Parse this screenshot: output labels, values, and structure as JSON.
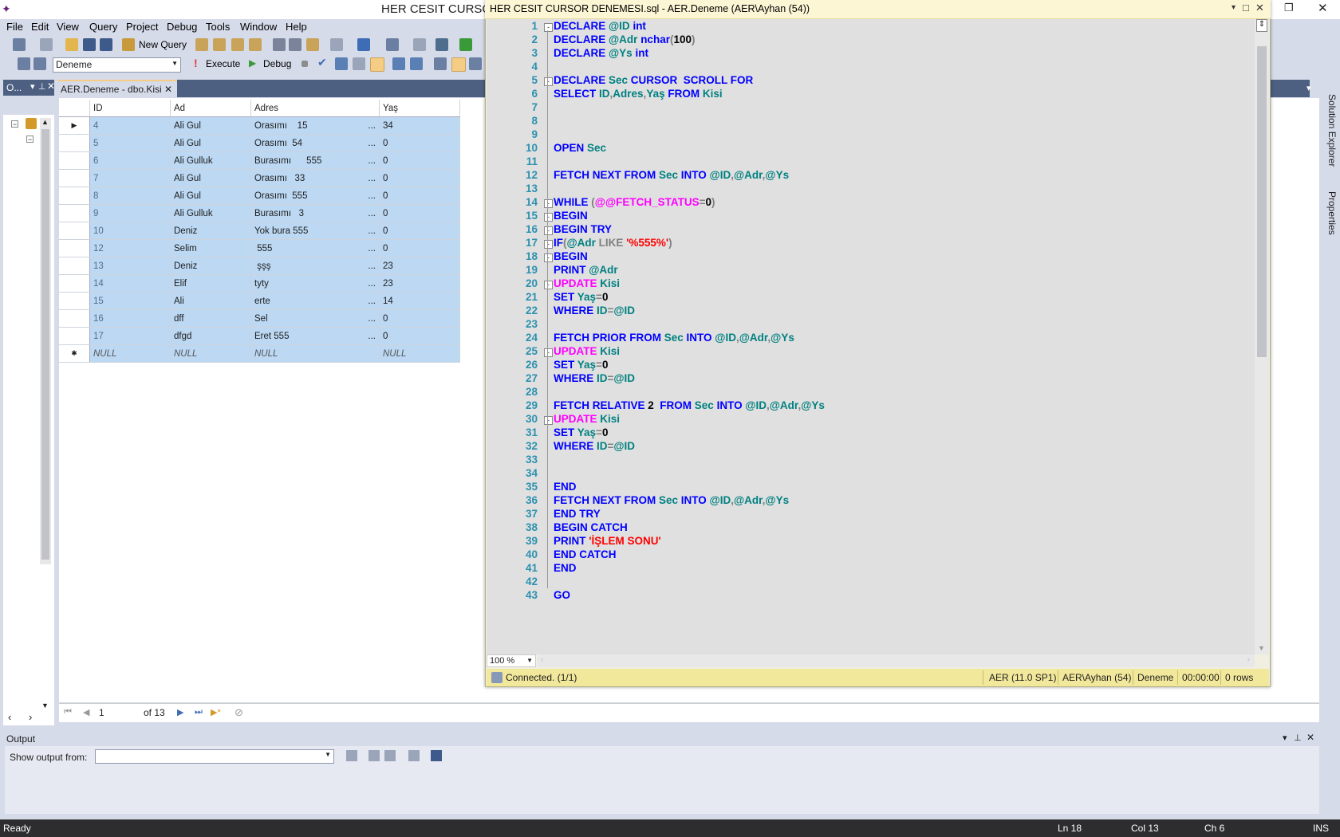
{
  "app": {
    "title": "HER CESIT CURSOR",
    "menu": [
      "File",
      "Edit",
      "View",
      "Query",
      "Project",
      "Debug",
      "Tools",
      "Window",
      "Help"
    ],
    "toolbar": {
      "new_query": "New Query",
      "database": "Deneme",
      "execute": "Execute",
      "debug": "Debug"
    },
    "object_explorer": {
      "title": "O..."
    }
  },
  "grid_doc": {
    "tab_label": "AER.Deneme - dbo.Kisi",
    "columns": [
      "ID",
      "Ad",
      "Adres",
      "Yaş"
    ],
    "rows": [
      {
        "id": "4",
        "ad": "Ali Gul",
        "adres": "Orasımı    15",
        "yas": "34"
      },
      {
        "id": "5",
        "ad": "Ali Gul",
        "adres": "Orasımı  54",
        "yas": "0"
      },
      {
        "id": "6",
        "ad": "Ali Gulluk",
        "adres": "Burasımı      555",
        "yas": "0"
      },
      {
        "id": "7",
        "ad": "Ali Gul",
        "adres": "Orasımı   33",
        "yas": "0"
      },
      {
        "id": "8",
        "ad": "Ali Gul",
        "adres": "Orasımı  555",
        "yas": "0"
      },
      {
        "id": "9",
        "ad": "Ali Gulluk",
        "adres": "Burasımı   3",
        "yas": "0"
      },
      {
        "id": "10",
        "ad": "Deniz",
        "adres": "Yok bura 555",
        "yas": "0"
      },
      {
        "id": "12",
        "ad": "Selim",
        "adres": " 555",
        "yas": "0"
      },
      {
        "id": "13",
        "ad": "Deniz",
        "adres": " şşş",
        "yas": "23"
      },
      {
        "id": "14",
        "ad": "Elif",
        "adres": "tyty",
        "yas": "23"
      },
      {
        "id": "15",
        "ad": "Ali",
        "adres": "erte",
        "yas": "14"
      },
      {
        "id": "16",
        "ad": "dff",
        "adres": "Sel",
        "yas": "0"
      },
      {
        "id": "17",
        "ad": "dfgd",
        "adres": "Eret 555",
        "yas": "0"
      }
    ],
    "new_row": {
      "id": "NULL",
      "ad": "NULL",
      "adres": "NULL",
      "yas": "NULL"
    },
    "ellipsis": "...",
    "nav": {
      "page": "1",
      "of": "of 13"
    }
  },
  "output": {
    "title": "Output",
    "show_from": "Show output from:"
  },
  "statusbar": {
    "ready": "Ready",
    "ln": "Ln 18",
    "col": "Col 13",
    "ch": "Ch 6",
    "ins": "INS"
  },
  "right_rail": {
    "solution_explorer": "Solution Explorer",
    "properties": "Properties"
  },
  "sql_window": {
    "title": "HER CESIT CURSOR DENEMESI.sql - AER.Deneme (AER\\Ayhan (54))",
    "zoom": "100 %",
    "status": {
      "connected": "Connected. (1/1)",
      "server": "AER (11.0 SP1)",
      "user": "AER\\Ayhan (54)",
      "db": "Deneme",
      "time": "00:00:00",
      "rows": "0 rows"
    },
    "lines": [
      {
        "n": "1",
        "fold": "-",
        "t": [
          [
            "kw",
            "DECLARE "
          ],
          [
            "vr",
            "@ID "
          ],
          [
            "kw",
            "int"
          ]
        ]
      },
      {
        "n": "2",
        "t": [
          [
            "kw",
            "DECLARE "
          ],
          [
            "vr",
            "@Adr "
          ],
          [
            "kw",
            "nchar"
          ],
          [
            "gr",
            "("
          ],
          [
            "bk",
            "100"
          ],
          [
            "gr",
            ")"
          ]
        ]
      },
      {
        "n": "3",
        "t": [
          [
            "kw",
            "DECLARE "
          ],
          [
            "vr",
            "@Ys "
          ],
          [
            "kw",
            "int"
          ]
        ]
      },
      {
        "n": "4",
        "t": []
      },
      {
        "n": "5",
        "fold": "-",
        "t": [
          [
            "kw",
            "DECLARE "
          ],
          [
            "vr",
            "Sec "
          ],
          [
            "kw",
            "CURSOR  SCROLL FOR"
          ]
        ]
      },
      {
        "n": "6",
        "t": [
          [
            "kw",
            "SELECT "
          ],
          [
            "vr",
            "ID"
          ],
          [
            "gr",
            ","
          ],
          [
            "vr",
            "Adres"
          ],
          [
            "gr",
            ","
          ],
          [
            "vr",
            "Yaş "
          ],
          [
            "kw",
            "FROM "
          ],
          [
            "vr",
            "Kisi"
          ]
        ]
      },
      {
        "n": "7",
        "t": []
      },
      {
        "n": "8",
        "t": []
      },
      {
        "n": "9",
        "t": []
      },
      {
        "n": "10",
        "t": [
          [
            "kw",
            "OPEN "
          ],
          [
            "vr",
            "Sec"
          ]
        ]
      },
      {
        "n": "11",
        "t": []
      },
      {
        "n": "12",
        "t": [
          [
            "kw",
            "FETCH NEXT FROM "
          ],
          [
            "vr",
            "Sec "
          ],
          [
            "kw",
            "INTO "
          ],
          [
            "vr",
            "@ID"
          ],
          [
            "gr",
            ","
          ],
          [
            "vr",
            "@Adr"
          ],
          [
            "gr",
            ","
          ],
          [
            "vr",
            "@Ys"
          ]
        ]
      },
      {
        "n": "13",
        "t": []
      },
      {
        "n": "14",
        "fold": "-",
        "t": [
          [
            "kw",
            "WHILE "
          ],
          [
            "gr",
            "("
          ],
          [
            "pk",
            "@@FETCH_STATUS"
          ],
          [
            "gr",
            "="
          ],
          [
            "bk",
            "0"
          ],
          [
            "gr",
            ")"
          ]
        ]
      },
      {
        "n": "15",
        "fold": "-",
        "t": [
          [
            "kw",
            "BEGIN"
          ]
        ]
      },
      {
        "n": "16",
        "fold": "-",
        "t": [
          [
            "kw",
            "BEGIN TRY"
          ]
        ]
      },
      {
        "n": "17",
        "fold": "-",
        "t": [
          [
            "kw",
            "IF"
          ],
          [
            "gr",
            "("
          ],
          [
            "vr",
            "@Adr "
          ],
          [
            "gr",
            "LIKE "
          ],
          [
            "st",
            "'%555%'"
          ],
          [
            "gr",
            ")"
          ]
        ]
      },
      {
        "n": "18",
        "fold": "-",
        "t": [
          [
            "kw",
            "BEGIN"
          ]
        ]
      },
      {
        "n": "19",
        "t": [
          [
            "kw",
            "PRINT "
          ],
          [
            "vr",
            "@Adr"
          ]
        ]
      },
      {
        "n": "20",
        "fold": "-",
        "t": [
          [
            "pk",
            "UPDATE "
          ],
          [
            "vr",
            "Kisi"
          ]
        ]
      },
      {
        "n": "21",
        "t": [
          [
            "kw",
            "SET "
          ],
          [
            "vr",
            "Yaş"
          ],
          [
            "gr",
            "="
          ],
          [
            "bk",
            "0"
          ]
        ]
      },
      {
        "n": "22",
        "t": [
          [
            "kw",
            "WHERE "
          ],
          [
            "vr",
            "ID"
          ],
          [
            "gr",
            "="
          ],
          [
            "vr",
            "@ID"
          ]
        ]
      },
      {
        "n": "23",
        "t": []
      },
      {
        "n": "24",
        "t": [
          [
            "kw",
            "FETCH PRIOR FROM "
          ],
          [
            "vr",
            "Sec "
          ],
          [
            "kw",
            "INTO "
          ],
          [
            "vr",
            "@ID"
          ],
          [
            "gr",
            ","
          ],
          [
            "vr",
            "@Adr"
          ],
          [
            "gr",
            ","
          ],
          [
            "vr",
            "@Ys"
          ]
        ]
      },
      {
        "n": "25",
        "fold": "-",
        "t": [
          [
            "pk",
            "UPDATE "
          ],
          [
            "vr",
            "Kisi"
          ]
        ]
      },
      {
        "n": "26",
        "t": [
          [
            "kw",
            "SET "
          ],
          [
            "vr",
            "Yaş"
          ],
          [
            "gr",
            "="
          ],
          [
            "bk",
            "0"
          ]
        ]
      },
      {
        "n": "27",
        "t": [
          [
            "kw",
            "WHERE "
          ],
          [
            "vr",
            "ID"
          ],
          [
            "gr",
            "="
          ],
          [
            "vr",
            "@ID"
          ]
        ]
      },
      {
        "n": "28",
        "t": []
      },
      {
        "n": "29",
        "t": [
          [
            "kw",
            "FETCH RELATIVE "
          ],
          [
            "bk",
            "2  "
          ],
          [
            "kw",
            "FROM "
          ],
          [
            "vr",
            "Sec "
          ],
          [
            "kw",
            "INTO "
          ],
          [
            "vr",
            "@ID"
          ],
          [
            "gr",
            ","
          ],
          [
            "vr",
            "@Adr"
          ],
          [
            "gr",
            ","
          ],
          [
            "vr",
            "@Ys"
          ]
        ]
      },
      {
        "n": "30",
        "fold": "-",
        "t": [
          [
            "pk",
            "UPDATE "
          ],
          [
            "vr",
            "Kisi"
          ]
        ]
      },
      {
        "n": "31",
        "t": [
          [
            "kw",
            "SET "
          ],
          [
            "vr",
            "Yaş"
          ],
          [
            "gr",
            "="
          ],
          [
            "bk",
            "0"
          ]
        ]
      },
      {
        "n": "32",
        "t": [
          [
            "kw",
            "WHERE "
          ],
          [
            "vr",
            "ID"
          ],
          [
            "gr",
            "="
          ],
          [
            "vr",
            "@ID"
          ]
        ]
      },
      {
        "n": "33",
        "t": []
      },
      {
        "n": "34",
        "t": []
      },
      {
        "n": "35",
        "t": [
          [
            "kw",
            "END"
          ]
        ]
      },
      {
        "n": "36",
        "t": [
          [
            "kw",
            "FETCH NEXT FROM "
          ],
          [
            "vr",
            "Sec "
          ],
          [
            "kw",
            "INTO "
          ],
          [
            "vr",
            "@ID"
          ],
          [
            "gr",
            ","
          ],
          [
            "vr",
            "@Adr"
          ],
          [
            "gr",
            ","
          ],
          [
            "vr",
            "@Ys"
          ]
        ]
      },
      {
        "n": "37",
        "t": [
          [
            "kw",
            "END TRY"
          ]
        ]
      },
      {
        "n": "38",
        "t": [
          [
            "kw",
            "BEGIN CATCH"
          ]
        ]
      },
      {
        "n": "39",
        "t": [
          [
            "kw",
            "PRINT "
          ],
          [
            "st",
            "'İŞLEM SONU'"
          ]
        ]
      },
      {
        "n": "40",
        "t": [
          [
            "kw",
            "END CATCH"
          ]
        ]
      },
      {
        "n": "41",
        "t": [
          [
            "kw",
            "END"
          ]
        ]
      },
      {
        "n": "42",
        "t": []
      },
      {
        "n": "43",
        "t": [
          [
            "kw",
            "GO"
          ]
        ]
      }
    ]
  }
}
